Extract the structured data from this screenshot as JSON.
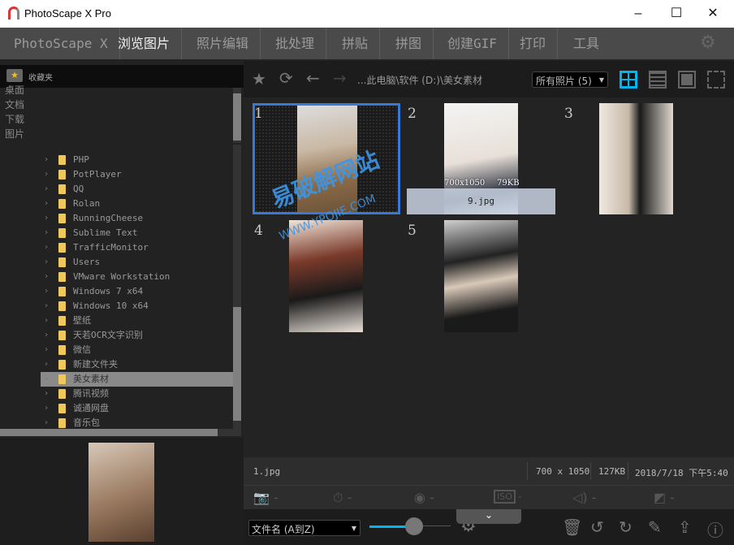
{
  "window": {
    "title": "PhotoScape X Pro",
    "minimize": "–",
    "maximize": "☐",
    "close": "✕"
  },
  "menu": {
    "items": [
      "PhotoScape X",
      "浏览图片",
      "照片编辑",
      "批处理",
      "拼贴",
      "拼图",
      "创建GIF",
      "打印",
      "工具"
    ],
    "active": "浏览图片",
    "settings_icon": "gear-icon"
  },
  "sidebar": {
    "favorites_label": "收藏夹",
    "favorites": [
      "桌面",
      "文档",
      "下载",
      "图片"
    ],
    "tree": [
      "PHP",
      "PotPlayer",
      "QQ",
      "Rolan",
      "RunningCheese",
      "Sublime Text",
      "TrafficMonitor",
      "Users",
      "VMware Workstation",
      "Windows 7 x64",
      "Windows 10 x64",
      "壁纸",
      "天若OCR文字识别",
      "微信",
      "新建文件夹",
      "美女素材",
      "腾讯视频",
      "诚通网盘",
      "音乐包"
    ],
    "selected": "美女素材"
  },
  "toolbar": {
    "path": "...此电脑\\软件 (D:)\\美女素材",
    "filter": "所有照片 (5)",
    "accent": "#00b4f0"
  },
  "grid": {
    "items": [
      {
        "num": "1",
        "selected": true
      },
      {
        "num": "2",
        "dims": "700x1050",
        "size": "79KB",
        "name": "9.jpg",
        "hover": true
      },
      {
        "num": "3"
      },
      {
        "num": "4"
      },
      {
        "num": "5"
      }
    ],
    "watermark": "易破解网站",
    "watermark_url": "WWW.YPOJIE.COM"
  },
  "info": {
    "filename": "1.jpg",
    "dims": "700 x 1050",
    "size": "127KB",
    "date": "2018/7/18 下午5:40"
  },
  "exif": {
    "dash": "-"
  },
  "bottom": {
    "sort": "文件名 (A到Z)",
    "zoom_level": 0.55
  }
}
